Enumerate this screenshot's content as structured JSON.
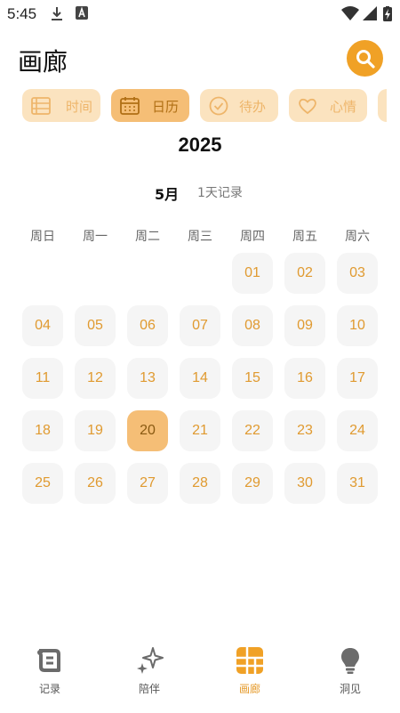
{
  "status_bar": {
    "time": "5:45"
  },
  "header": {
    "title": "画廊"
  },
  "tabs": [
    {
      "label": "时间",
      "icon": "timeline-icon",
      "active": false
    },
    {
      "label": "日历",
      "icon": "calendar-icon",
      "active": true
    },
    {
      "label": "待办",
      "icon": "check-circle-icon",
      "active": false
    },
    {
      "label": "心情",
      "icon": "heart-icon",
      "active": false
    }
  ],
  "calendar": {
    "year": "2025",
    "month": "5月",
    "record_count": "1天记录",
    "weekdays": [
      "周日",
      "周一",
      "周二",
      "周三",
      "周四",
      "周五",
      "周六"
    ],
    "days": [
      "01",
      "02",
      "03",
      "04",
      "05",
      "06",
      "07",
      "08",
      "09",
      "10",
      "11",
      "12",
      "13",
      "14",
      "15",
      "16",
      "17",
      "18",
      "19",
      "20",
      "21",
      "22",
      "23",
      "24",
      "25",
      "26",
      "27",
      "28",
      "29",
      "30",
      "31"
    ],
    "selected_day": "20"
  },
  "bottom_nav": [
    {
      "label": "记录",
      "icon": "scroll-icon",
      "active": false
    },
    {
      "label": "陪伴",
      "icon": "sparkle-icon",
      "active": false
    },
    {
      "label": "画廊",
      "icon": "gallery-grid-icon",
      "active": true
    },
    {
      "label": "洞见",
      "icon": "lightbulb-icon",
      "active": false
    }
  ],
  "colors": {
    "accent": "#f0a126",
    "tab_bg": "#fbe3bf",
    "tab_active_bg": "#f5be76",
    "day_bg": "#f5f5f5",
    "day_text": "#e09a30"
  }
}
